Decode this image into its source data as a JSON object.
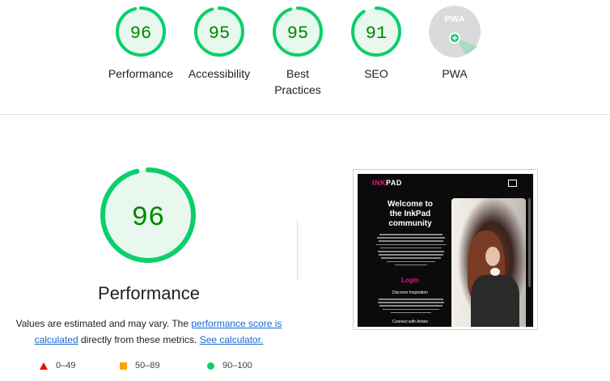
{
  "categories": [
    {
      "score": "96",
      "label": "Performance",
      "value": 96,
      "status": "pass"
    },
    {
      "score": "95",
      "label": "Accessibility",
      "value": 95,
      "status": "pass"
    },
    {
      "score": "95",
      "label": "Best Practices",
      "value": 95,
      "status": "pass"
    },
    {
      "score": "91",
      "label": "SEO",
      "value": 91,
      "status": "pass"
    },
    {
      "score": "PWA",
      "label": "PWA",
      "value": null,
      "status": "pwa"
    }
  ],
  "main": {
    "score": "96",
    "value": 96,
    "title": "Performance",
    "note_prefix": "Values are estimated and may vary. The ",
    "note_link1": "performance score is calculated",
    "note_middle": " directly from these metrics. ",
    "note_link2": "See calculator."
  },
  "legend": [
    {
      "icon": "red-triangle-icon",
      "range": "0–49"
    },
    {
      "icon": "orange-square-icon",
      "range": "50–89"
    },
    {
      "icon": "green-circle-icon",
      "range": "90–100"
    }
  ],
  "screenshot": {
    "logo_ink": "INK",
    "logo_pad": "PAD",
    "headline_1": "Welcome to",
    "headline_2": "the InkPad",
    "headline_3": "community",
    "login": "Login",
    "discover": "Discover Inspiration",
    "connect": "Connect with Artists"
  },
  "colors": {
    "pass": "#0cce6b",
    "pass_text": "#008800",
    "pass_fill": "#e8f8ee",
    "fail": "#eb0f00",
    "average": "#ffa400",
    "link": "#1967d2"
  }
}
